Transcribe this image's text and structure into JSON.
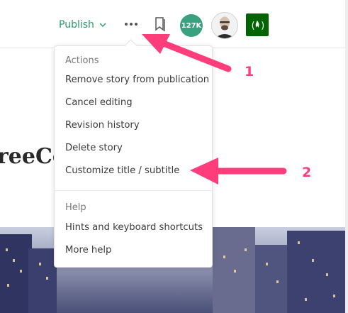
{
  "topbar": {
    "publish_label": "Publish",
    "more_icon": "ellipsis-icon",
    "bookmark_icon": "bookmark-icon",
    "notifications_count": "127K",
    "publication_icon": "freecodecamp-fire-icon"
  },
  "article": {
    "title_fragment": "reeCo"
  },
  "menu": {
    "actions_label": "Actions",
    "actions": [
      "Remove story from publication",
      "Cancel editing",
      "Revision history",
      "Delete story",
      "Customize title / subtitle"
    ],
    "help_label": "Help",
    "help": [
      "Hints and keyboard shortcuts",
      "More help"
    ]
  },
  "annotations": {
    "label_1": "1",
    "label_2": "2",
    "color": "#ff3d7a"
  },
  "colors": {
    "accent_green": "#2a9a6b",
    "badge_green": "#3aa17e",
    "publication_green": "#006400"
  }
}
